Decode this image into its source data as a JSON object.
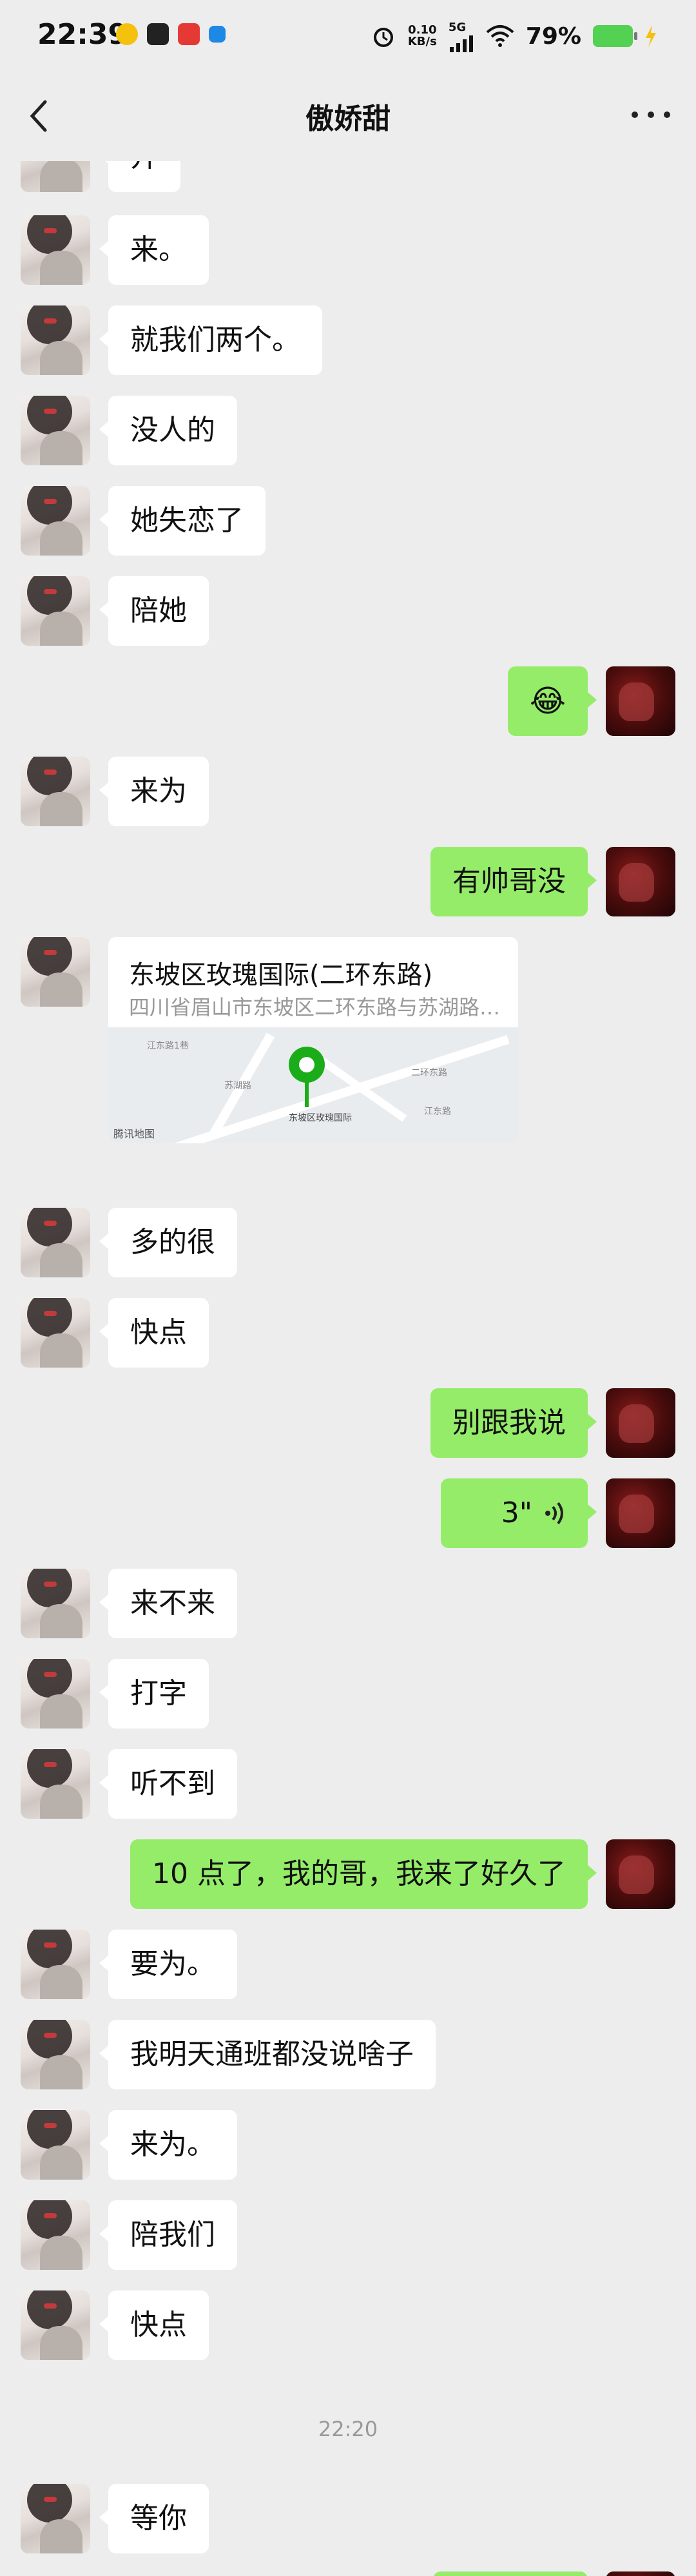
{
  "status_bar": {
    "time": "22:39",
    "net_speed": "0.10",
    "net_unit": "KB/s",
    "network": "5G",
    "battery": "79%"
  },
  "nav": {
    "title": "傲娇甜"
  },
  "messages": {
    "m0": "开",
    "m1": "来。",
    "m2": "就我们两个。",
    "m3": "没人的",
    "m4": "她失恋了",
    "m5": "陪她",
    "m6_emoji": "😂",
    "m7": "来为",
    "m8": "有帅哥没",
    "location": {
      "title": "东坡区玫瑰国际(二环东路)",
      "address": "四川省眉山市东坡区二环东路与苏湖路…",
      "map_label": "东坡区玫瑰国际",
      "map_brand": "腾讯地图",
      "road1": "江东路1巷",
      "road2": "苏湖路",
      "road3": "二环东路",
      "road4": "江东路"
    },
    "m10": "多的很",
    "m11": "快点",
    "m12": "别跟我说",
    "m13_voice": "3\"",
    "m14": "来不来",
    "m15": "打字",
    "m16": "听不到",
    "m17": "10 点了，我的哥，我来了好久了",
    "m18": "要为。",
    "m19": "我明天通班都没说啥子",
    "m20": "来为。",
    "m21": "陪我们",
    "m22": "快点",
    "timestamp": "22:20",
    "m23": "等你"
  },
  "colors": {
    "background": "#ededed",
    "outgoing_bubble": "#95ec69",
    "incoming_bubble": "#ffffff",
    "pin": "#1aad19"
  },
  "icons": [
    "back-arrow-icon",
    "more-icon",
    "wifi-icon",
    "signal-icon",
    "alarm-icon",
    "voice-wave-icon",
    "map-pin-icon"
  ]
}
